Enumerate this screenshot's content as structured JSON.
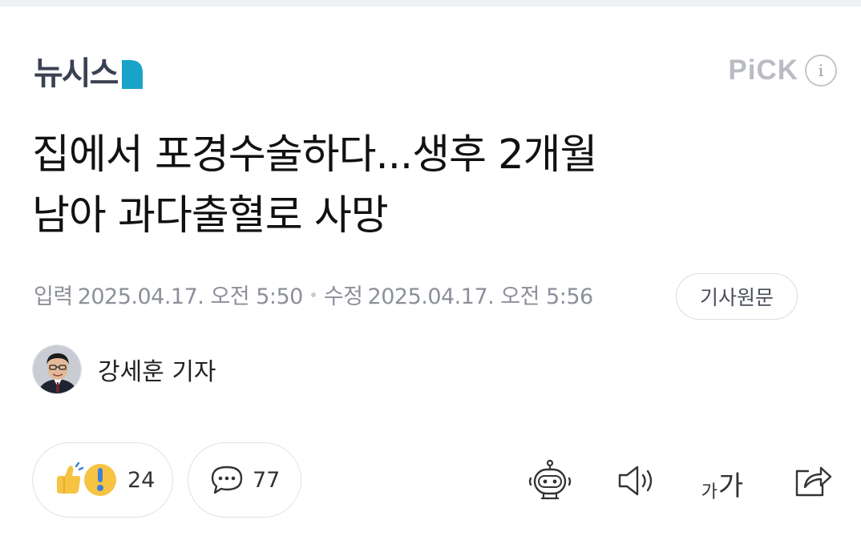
{
  "header": {
    "brand": "뉴시스",
    "pick_label": "PiCK",
    "info_label": "i",
    "colors": {
      "brand_text": "#3a4152",
      "brand_mark": "#1aa3c9",
      "pick": "#b9bcc2"
    }
  },
  "article": {
    "title_line1": "집에서 포경수술하다...생후 2개월",
    "title_line2": "남아 과다출혈로 사망",
    "published_label": "입력",
    "published_value": "2025.04.17. 오전 5:50",
    "modified_label": "수정",
    "modified_value": "2025.04.17. 오전 5:56",
    "original_button": "기사원문"
  },
  "reporter": {
    "name": "강세훈 기자"
  },
  "actions": {
    "reaction_count": "24",
    "comment_count": "77",
    "fontsize_small": "가",
    "fontsize_big": "가",
    "icons": [
      "reaction-emoji-icon",
      "comment-icon",
      "ai-summary-bot-icon",
      "speaker-icon",
      "font-size-icon",
      "share-icon"
    ]
  }
}
